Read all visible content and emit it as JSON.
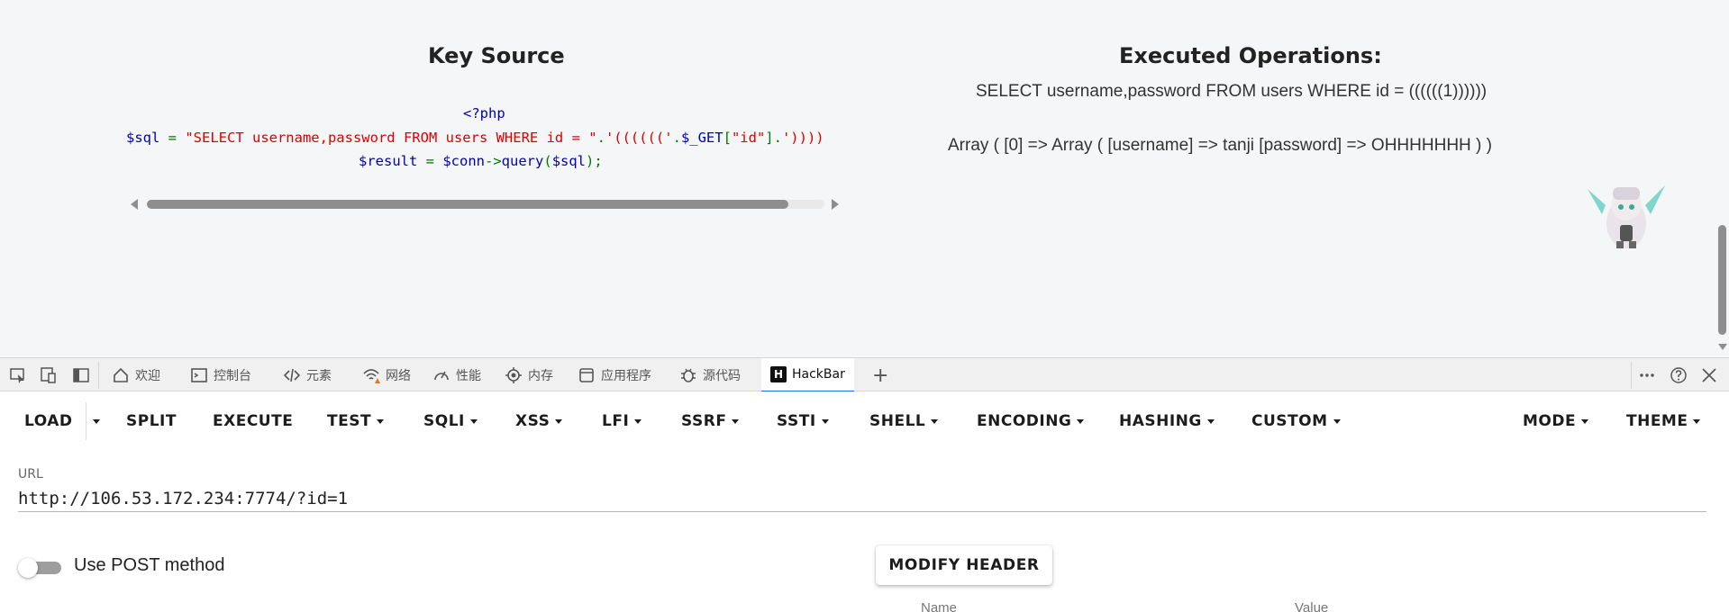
{
  "page": {
    "key_source": {
      "title": "Key Source",
      "code": {
        "line1": "<?php",
        "line2_var": "$sql",
        "line2_eq": " = ",
        "line2_str1": "\"SELECT username,password FROM users WHERE id = \"",
        "line2_op1": ".",
        "line2_str2": "'(((((('",
        "line2_op2": ".",
        "line2_get": "$_GET",
        "line2_br1": "[",
        "line2_key": "\"id\"",
        "line2_br2": "]",
        "line2_op3": ".",
        "line2_str3": "'))))",
        "line3_var": "$result",
        "line3_eq": " = ",
        "line3_conn": "$conn",
        "line3_arrow": "->",
        "line3_fn": "query",
        "line3_p1": "(",
        "line3_arg": "$sql",
        "line3_p2": ");"
      }
    },
    "executed": {
      "title": "Executed Operations:",
      "query": "SELECT username,password FROM users WHERE id = ((((((1))))))",
      "result": "Array ( [0] => Array ( [username] => tanji [password] => OHHHHHHH ) )"
    }
  },
  "devtools": {
    "tabs": [
      {
        "label": "欢迎",
        "icon": "home-icon"
      },
      {
        "label": "控制台",
        "icon": "console-icon"
      },
      {
        "label": "元素",
        "icon": "code-icon"
      },
      {
        "label": "网络",
        "icon": "wifi-warning-icon"
      },
      {
        "label": "性能",
        "icon": "gauge-icon"
      },
      {
        "label": "内存",
        "icon": "chip-icon"
      },
      {
        "label": "应用程序",
        "icon": "app-window-icon"
      },
      {
        "label": "源代码",
        "icon": "bug-icon"
      },
      {
        "label": "HackBar",
        "icon": "hackbar-logo-icon"
      }
    ],
    "hackbar_logo_letter": "H",
    "add_tab": "+"
  },
  "hackbar": {
    "toolbar": {
      "load": "LOAD",
      "split": "SPLIT",
      "execute": "EXECUTE",
      "test": "TEST",
      "sqli": "SQLI",
      "xss": "XSS",
      "lfi": "LFI",
      "ssrf": "SSRF",
      "ssti": "SSTI",
      "shell": "SHELL",
      "encoding": "ENCODING",
      "hashing": "HASHING",
      "custom": "CUSTOM",
      "mode": "MODE",
      "theme": "THEME"
    },
    "url_label": "URL",
    "url_value": "http://106.53.172.234:7774/?id=1",
    "post_label": "Use POST method",
    "post_enabled": false,
    "modify_header": "MODIFY HEADER",
    "headers_columns": {
      "name": "Name",
      "value": "Value"
    }
  },
  "colors": {
    "php_keyword": "#0000bb",
    "php_string": "#dd0000",
    "php_operator": "#007700",
    "active_tab_underline": "#1a73e8"
  }
}
